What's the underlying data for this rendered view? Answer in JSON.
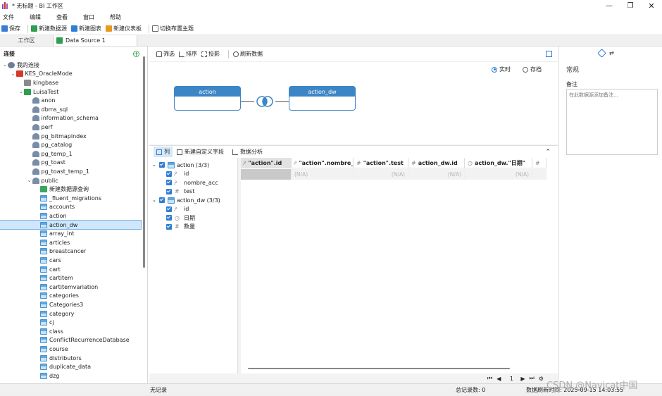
{
  "window": {
    "title": "* 无标题 - BI 工作区"
  },
  "menu": [
    "文件",
    "编辑",
    "查看",
    "窗口",
    "帮助"
  ],
  "toolbar": {
    "save": "保存",
    "new_datasource": "新建数据源",
    "new_chart": "新建图表",
    "new_dashboard": "新建仪表板",
    "switch_theme": "切换布置主题"
  },
  "tabs": {
    "workspace": "工作区",
    "datasource": "Data Source 1"
  },
  "left": {
    "header": "连接",
    "tree": [
      {
        "label": "我的连接",
        "level": 0,
        "icon": "connection-icon",
        "twisty": "open"
      },
      {
        "label": "KES_OracleMode",
        "level": 1,
        "icon": "kes-server-icon",
        "twisty": "open"
      },
      {
        "label": "kingbase",
        "level": 2,
        "icon": "database-icon",
        "twisty": ""
      },
      {
        "label": "LuisaTest",
        "level": 2,
        "icon": "database-icon",
        "twisty": "open"
      },
      {
        "label": "anon",
        "level": 3,
        "icon": "schema-icon",
        "twisty": ""
      },
      {
        "label": "dbms_sql",
        "level": 3,
        "icon": "schema-icon",
        "twisty": ""
      },
      {
        "label": "information_schema",
        "level": 3,
        "icon": "schema-icon",
        "twisty": ""
      },
      {
        "label": "perf",
        "level": 3,
        "icon": "schema-icon",
        "twisty": ""
      },
      {
        "label": "pg_bitmapindex",
        "level": 3,
        "icon": "schema-icon",
        "twisty": ""
      },
      {
        "label": "pg_catalog",
        "level": 3,
        "icon": "schema-icon",
        "twisty": ""
      },
      {
        "label": "pg_temp_1",
        "level": 3,
        "icon": "schema-icon",
        "twisty": ""
      },
      {
        "label": "pg_toast",
        "level": 3,
        "icon": "schema-icon",
        "twisty": ""
      },
      {
        "label": "pg_toast_temp_1",
        "level": 3,
        "icon": "schema-icon",
        "twisty": ""
      },
      {
        "label": "public",
        "level": 3,
        "icon": "schema-icon",
        "twisty": "open"
      },
      {
        "label": "新建数据源查询",
        "level": 4,
        "icon": "new-query-icon",
        "twisty": ""
      },
      {
        "label": "_fluent_migrations",
        "level": 4,
        "icon": "table-icon",
        "twisty": ""
      },
      {
        "label": "accounts",
        "level": 4,
        "icon": "table-icon",
        "twisty": ""
      },
      {
        "label": "action",
        "level": 4,
        "icon": "table-icon",
        "twisty": ""
      },
      {
        "label": "action_dw",
        "level": 4,
        "icon": "table-icon",
        "twisty": "",
        "selected": true
      },
      {
        "label": "array_int",
        "level": 4,
        "icon": "table-icon",
        "twisty": ""
      },
      {
        "label": "articles",
        "level": 4,
        "icon": "table-icon",
        "twisty": ""
      },
      {
        "label": "breastcancer",
        "level": 4,
        "icon": "table-icon",
        "twisty": ""
      },
      {
        "label": "cars",
        "level": 4,
        "icon": "table-icon",
        "twisty": ""
      },
      {
        "label": "cart",
        "level": 4,
        "icon": "table-icon",
        "twisty": ""
      },
      {
        "label": "cartitem",
        "level": 4,
        "icon": "table-icon",
        "twisty": ""
      },
      {
        "label": "cartitemvariation",
        "level": 4,
        "icon": "table-icon",
        "twisty": ""
      },
      {
        "label": "categories",
        "level": 4,
        "icon": "table-icon",
        "twisty": ""
      },
      {
        "label": "Categories3",
        "level": 4,
        "icon": "table-icon",
        "twisty": ""
      },
      {
        "label": "category",
        "level": 4,
        "icon": "table-icon",
        "twisty": ""
      },
      {
        "label": "cj",
        "level": 4,
        "icon": "table-icon",
        "twisty": ""
      },
      {
        "label": "class",
        "level": 4,
        "icon": "table-icon",
        "twisty": ""
      },
      {
        "label": "ConflictRecurrenceDatabase",
        "level": 4,
        "icon": "table-icon",
        "twisty": ""
      },
      {
        "label": "course",
        "level": 4,
        "icon": "table-icon",
        "twisty": ""
      },
      {
        "label": "distributors",
        "level": 4,
        "icon": "table-icon",
        "twisty": ""
      },
      {
        "label": "duplicate_data",
        "level": 4,
        "icon": "table-icon",
        "twisty": ""
      },
      {
        "label": "dzg",
        "level": 4,
        "icon": "table-icon",
        "twisty": ""
      }
    ]
  },
  "center": {
    "filter": "筛选",
    "sort": "排序",
    "project": "投影",
    "refresh": "刷新数据",
    "live": "实时",
    "archive": "存档",
    "node_left": "action",
    "node_right": "action_dw",
    "tab_columns": "列",
    "tab_new_field": "新建自定义字段",
    "tab_analysis": "数据分析",
    "fields": [
      {
        "label": "action (3/3)",
        "group": true,
        "icon": "table-icon"
      },
      {
        "label": "id",
        "group": false,
        "icon": "text-type-icon"
      },
      {
        "label": "nombre_acc",
        "group": false,
        "icon": "text-type-icon"
      },
      {
        "label": "test",
        "group": false,
        "icon": "number-type-icon"
      },
      {
        "label": "action_dw (3/3)",
        "group": true,
        "icon": "table-icon"
      },
      {
        "label": "id",
        "group": false,
        "icon": "text-type-icon"
      },
      {
        "label": "日期",
        "group": false,
        "icon": "date-type-icon"
      },
      {
        "label": "数量",
        "group": false,
        "icon": "number-type-icon"
      }
    ],
    "grid_headers": [
      "\"action\".id",
      "\"action\".nombre_ac",
      "\"action\".test",
      "action_dw.id",
      "action_dw.\"日期\"",
      "#"
    ],
    "grid_cells": [
      "",
      "(N/A)",
      "(N/A)",
      "(N/A)",
      "(N/A)",
      ""
    ],
    "page": "1"
  },
  "right": {
    "section": "常规",
    "note_label": "备注",
    "note_placeholder": "在此数据源添加备注..."
  },
  "status": {
    "left": "无记录",
    "middle": "总记录数: 0",
    "right": "数据刷新时间: 2025-09-15 14:03:55",
    "watermark": "CSDN @Navicat中国"
  },
  "colors": {
    "accent": "#3d86c6",
    "selection": "#cfe6fb"
  }
}
